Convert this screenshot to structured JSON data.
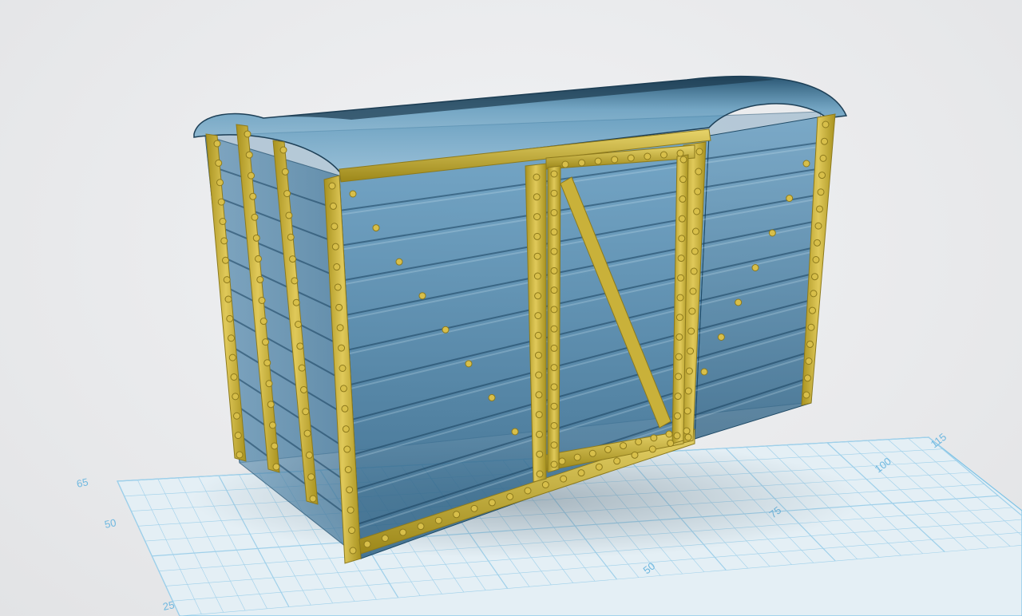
{
  "viewport": {
    "background": "#ebecee",
    "grid_color": "#7ec3e6",
    "grid_fill": "#e6f1f7"
  },
  "model": {
    "frame_color": "#c9b13a",
    "frame_dark": "#8d7a1d",
    "panel_color": "#3f7ea3",
    "rivet_color": "#d8bf4a"
  },
  "grid": {
    "left_axis_labels": [
      "65",
      "50",
      "25"
    ],
    "front_axis_labels": [
      "115",
      "100",
      "75",
      "50"
    ]
  }
}
